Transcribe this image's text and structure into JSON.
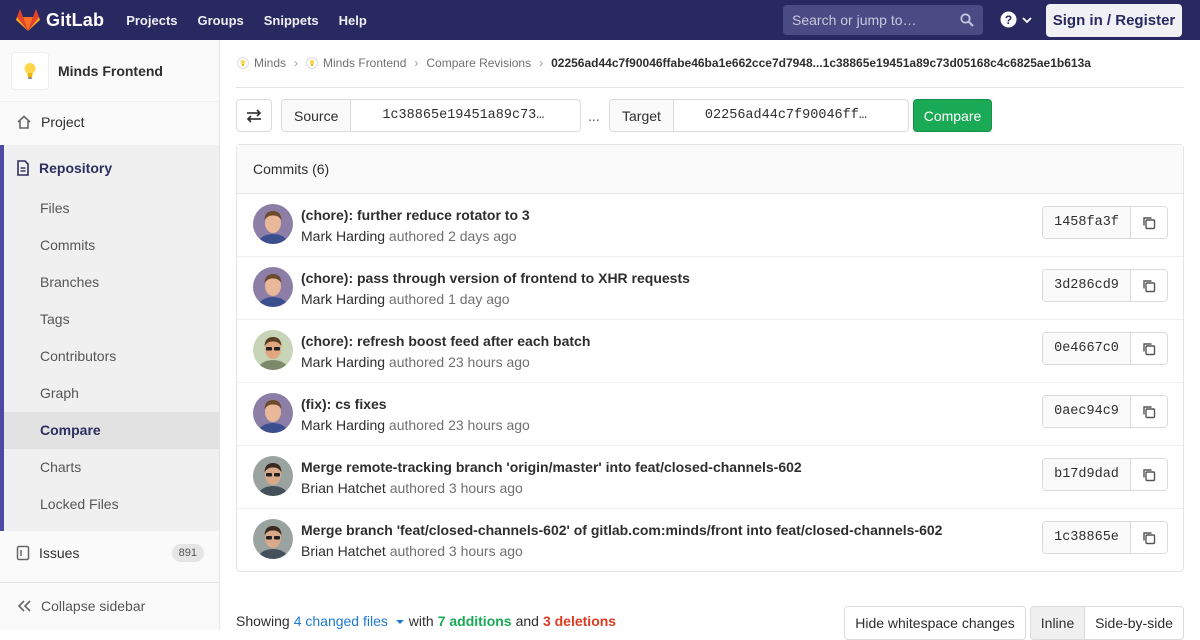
{
  "navbar": {
    "brand": "GitLab",
    "links": [
      "Projects",
      "Groups",
      "Snippets",
      "Help"
    ],
    "search_placeholder": "Search or jump to…",
    "signin_label": "Sign in / Register"
  },
  "sidebar": {
    "project_name": "Minds Frontend",
    "project_label": "Project",
    "repository_label": "Repository",
    "repo_items": [
      "Files",
      "Commits",
      "Branches",
      "Tags",
      "Contributors",
      "Graph",
      "Compare",
      "Charts",
      "Locked Files"
    ],
    "active_item": "Compare",
    "issues_label": "Issues",
    "issues_count": "891",
    "collapse_label": "Collapse sidebar"
  },
  "breadcrumb": {
    "items": [
      "Minds",
      "Minds Frontend",
      "Compare Revisions"
    ],
    "current": "02256ad44c7f90046ffabe46ba1e662cce7d7948...1c38865e19451a89c73d05168c4c6825ae1b613a"
  },
  "compare_form": {
    "source_label": "Source",
    "source_value": "1c38865e19451a89c73…",
    "separator": "...",
    "target_label": "Target",
    "target_value": "02256ad44c7f90046ff…",
    "compare_button": "Compare"
  },
  "commits": {
    "header": "Commits (6)",
    "verb": "authored",
    "rows": [
      {
        "title": "(chore): further reduce rotator to 3",
        "author": "Mark Harding",
        "time": "2 days ago",
        "sha": "1458fa3f",
        "avatar": "mark"
      },
      {
        "title": "(chore): pass through version of frontend to XHR requests",
        "author": "Mark Harding",
        "time": "1 day ago",
        "sha": "3d286cd9",
        "avatar": "mark"
      },
      {
        "title": "(chore): refresh boost feed after each batch",
        "author": "Mark Harding",
        "time": "23 hours ago",
        "sha": "0e4667c0",
        "avatar": "mark-sunglasses"
      },
      {
        "title": "(fix): cs fixes",
        "author": "Mark Harding",
        "time": "23 hours ago",
        "sha": "0aec94c9",
        "avatar": "mark"
      },
      {
        "title": "Merge remote-tracking branch 'origin/master' into feat/closed-channels-602",
        "author": "Brian Hatchet",
        "time": "3 hours ago",
        "sha": "b17d9dad",
        "avatar": "brian"
      },
      {
        "title": "Merge branch 'feat/closed-channels-602' of gitlab.com:minds/front into feat/closed-channels-602",
        "author": "Brian Hatchet",
        "time": "3 hours ago",
        "sha": "1c38865e",
        "avatar": "brian"
      }
    ]
  },
  "summary": {
    "showing": "Showing",
    "changed_files": "4 changed files",
    "with": "with",
    "additions": "7 additions",
    "and": "and",
    "deletions": "3 deletions",
    "hide_whitespace": "Hide whitespace changes",
    "inline": "Inline",
    "side_by_side": "Side-by-side"
  },
  "colors": {
    "navbar": "#292961",
    "accent": "#4b4ba3",
    "compare_button": "#1aaa55",
    "additions": "#1aaa55",
    "deletions": "#db3b21",
    "link": "#1f78d1"
  }
}
